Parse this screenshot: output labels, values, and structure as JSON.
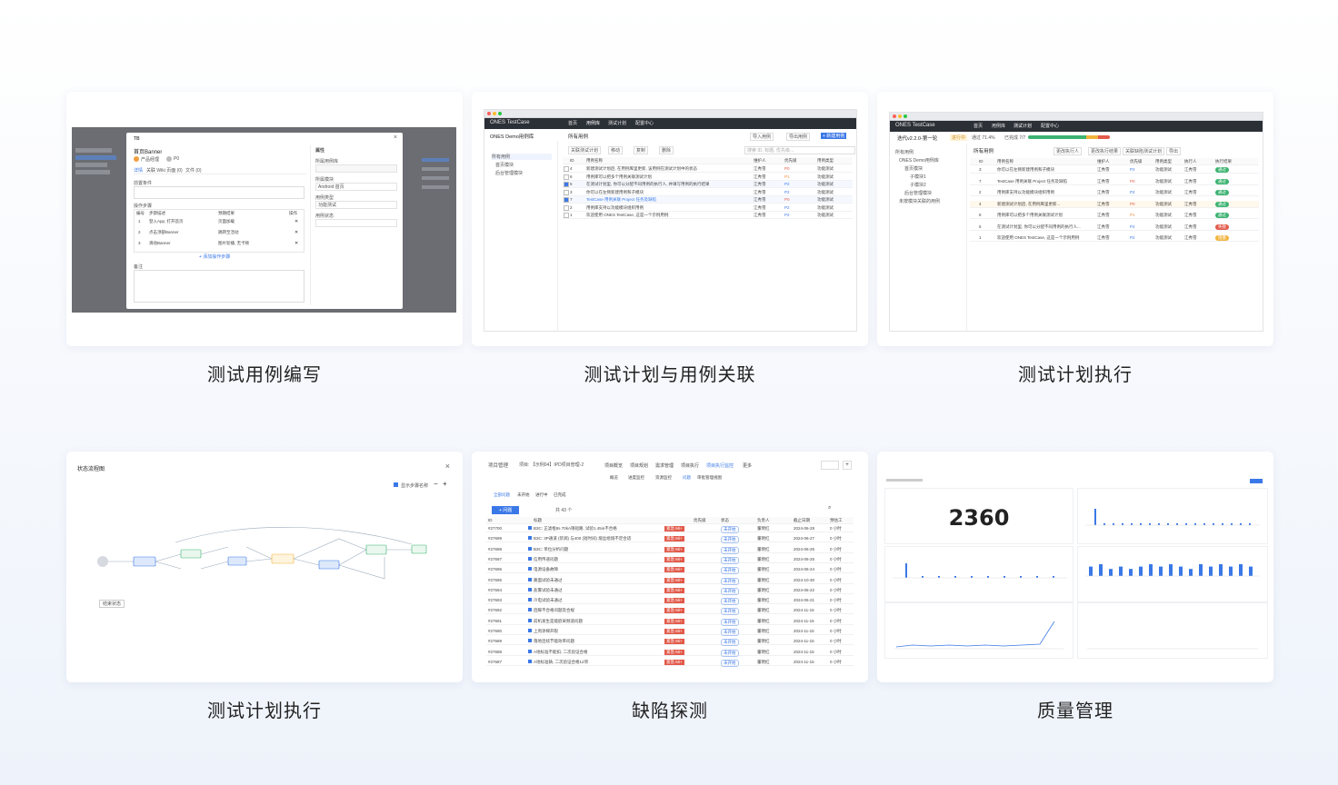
{
  "cards": [
    {
      "caption": "测试用例编写"
    },
    {
      "caption": "测试计划与用例关联"
    },
    {
      "caption": "测试计划执行"
    },
    {
      "caption": "测试计划执行"
    },
    {
      "caption": "缺陷探测"
    },
    {
      "caption": "质量管理"
    }
  ],
  "shot1": {
    "dialog_title": "TB",
    "field_title": "首页Banner",
    "owner": "产品经理",
    "priority": "P0",
    "tabs": [
      "详情",
      "关联 Wiki 页面 (0)",
      "文件 (0)"
    ],
    "precondition_label": "前置条件",
    "steps_label": "操作步骤",
    "steps_cols": [
      "编号",
      "步骤描述",
      "预期结果",
      "操作"
    ],
    "steps": [
      {
        "no": "1",
        "desc": "登入App, 打开首页",
        "exp": "页面加载"
      },
      {
        "no": "2",
        "desc": "点击顶部Banner",
        "exp": "跳转至活动"
      },
      {
        "no": "3",
        "desc": "滑动Banner",
        "exp": "图片轮播, 无卡顿"
      }
    ],
    "add_step": "+ 添加操作步骤",
    "remark_label": "备注",
    "props_label": "属性",
    "prop1": "所属用例库",
    "prop2": "所属模块",
    "prop2_val": "Android 首页",
    "prop3": "用例类型",
    "prop3_val": "功能测试",
    "prop4": "用例状态"
  },
  "shot2": {
    "brand": "ONES TestCase",
    "nav": [
      "首页",
      "用例库",
      "测试计划",
      "配置中心"
    ],
    "lib": "ONES Demo用例库",
    "tree": [
      "所有用例",
      "首页模块",
      "后台管理模块"
    ],
    "header": "所有用例",
    "buttons": [
      "导入用例",
      "导出用例",
      "+ 新建用例"
    ],
    "toolbar": [
      "关联测试计划",
      "移动",
      "复制",
      "删除"
    ],
    "search_placeholder": "搜索 ID, 标题, 优先级...",
    "cols": [
      "ID",
      "用例名称",
      "维护人",
      "优先级",
      "用例类型"
    ],
    "rows": [
      {
        "id": "4",
        "name": "新建测试计划后, 在用例库里更新, 该用例在测试计划中的状态",
        "owner": "江秀雪",
        "pri": "P0",
        "type": "功能测试"
      },
      {
        "id": "6",
        "name": "用例库可以把多个用例关联测试计划",
        "owner": "江秀雪",
        "pri": "P1",
        "type": "功能测试"
      },
      {
        "id": "5",
        "name": "在测试计划里, 你可以分配不同用例的执行人, 并填写用例的执行结果",
        "owner": "江秀雪",
        "pri": "P2",
        "type": "功能测试"
      },
      {
        "id": "3",
        "name": "你可以在左侧新建用例和子模块",
        "owner": "江秀雪",
        "pri": "P2",
        "type": "功能测试"
      },
      {
        "id": "7",
        "name": "TestCase 用例关联 Project 任务及缺陷",
        "owner": "江秀雪",
        "pri": "P0",
        "type": "功能测试"
      },
      {
        "id": "2",
        "name": "用例库支持以功能模块组织用例",
        "owner": "江秀雪",
        "pri": "P2",
        "type": "功能测试"
      },
      {
        "id": "1",
        "name": "欢迎使用 ONES TestCase, 这是一个示例用例",
        "owner": "江秀雪",
        "pri": "P2",
        "type": "功能测试"
      }
    ]
  },
  "shot3": {
    "plan": "迭代v2.2.0-第一轮",
    "progress_text": "进行中",
    "pass_rate": "通过 71.4%",
    "done": "已完成 7/7",
    "tree": [
      "所有用例",
      "ONES Demo用例库",
      "首页模块",
      "子模块1",
      "子模块2",
      "后台管理模块",
      "未按模块关联的用例"
    ],
    "header": "所有用例",
    "toolbar": [
      "更改执行人",
      "更改执行结果",
      "关联缺陷测试计划",
      "导出"
    ],
    "cols": [
      "ID",
      "用例名称",
      "维护人",
      "优先级",
      "用例类型",
      "执行人",
      "执行结果"
    ],
    "rows": [
      {
        "id": "3",
        "name": "你可以在左侧新建用例和子模块",
        "owner": "江秀雪",
        "pri": "P2",
        "type": "功能测试",
        "exec": "江秀雪",
        "res": "通过"
      },
      {
        "id": "7",
        "name": "TestCase 用例关联 Project 任务及缺陷",
        "owner": "江秀雪",
        "pri": "P0",
        "type": "功能测试",
        "exec": "江秀雪",
        "res": "通过"
      },
      {
        "id": "2",
        "name": "用例库支持以功能模块组织用例",
        "owner": "江秀雪",
        "pri": "P2",
        "type": "功能测试",
        "exec": "江秀雪",
        "res": "通过"
      },
      {
        "id": "4",
        "name": "新建测试计划后, 在用例库里更新...",
        "owner": "江秀雪",
        "pri": "P0",
        "type": "功能测试",
        "exec": "江秀雪",
        "res": "通过"
      },
      {
        "id": "6",
        "name": "用例库可以把多个用例关联测试计划",
        "owner": "江秀雪",
        "pri": "P1",
        "type": "功能测试",
        "exec": "江秀雪",
        "res": "通过"
      },
      {
        "id": "5",
        "name": "在测试计划里, 你可以分配不同用例的执行人...",
        "owner": "江秀雪",
        "pri": "P2",
        "type": "功能测试",
        "exec": "江秀雪",
        "res": "失败"
      },
      {
        "id": "1",
        "name": "欢迎使用 ONES TestCase, 这是一个示例用例",
        "owner": "江秀雪",
        "pri": "P2",
        "type": "功能测试",
        "exec": "江秀雪",
        "res": "阻塞"
      }
    ]
  },
  "shot4": {
    "title": "状态流程图",
    "toggle": "显示步骤名称",
    "legend": "结束状态"
  },
  "shot5": {
    "crumb": "项目管理",
    "project": "项目: 【示例04】IPD项目管理-2",
    "tabs": [
      "项目概览",
      "项目规划",
      "需求管理",
      "项目执行",
      "项目执行监控",
      "更多"
    ],
    "subtabs": [
      "概览",
      "进度监控",
      "资源监控",
      "问题",
      "审批管理视图"
    ],
    "filter_tabs": [
      "全部问题",
      "未开始",
      "进行中",
      "已完成"
    ],
    "new_btn": "+ 问题",
    "total": "共 43 个",
    "cols": [
      "ID",
      "标题",
      "优先级",
      "状态",
      "负责人",
      "截止日期",
      "预估工"
    ],
    "rows": [
      {
        "id": "#27700",
        "title": "B3C: 正滤框8s 70kA限短路, 试验1.45in不合格",
        "owner": "董明红",
        "date": "2024-06-28",
        "est": "0 小时"
      },
      {
        "id": "#27699",
        "title": "B3C: 3P通道 (装调) 与400 (短时间) 熔丝组熔不足合适",
        "owner": "董明红",
        "date": "2024-06-27",
        "est": "0 小时"
      },
      {
        "id": "#27698",
        "title": "B3C: 单位分析问题",
        "owner": "董明红",
        "date": "2024-06-26",
        "est": "0 小时"
      },
      {
        "id": "#27697",
        "title": "信用传递问题",
        "owner": "董明红",
        "date": "2024-06-25",
        "est": "0 小时"
      },
      {
        "id": "#27696",
        "title": "电源设备故障",
        "owner": "董明红",
        "date": "2024-06-24",
        "est": "0 小时"
      },
      {
        "id": "#27695",
        "title": "路面试验未通过",
        "owner": "董明红",
        "date": "2024-10-30",
        "est": "0 小时"
      },
      {
        "id": "#27694",
        "title": "盐雾试验未通过",
        "owner": "董明红",
        "date": "2024-06-22",
        "est": "0 小时"
      },
      {
        "id": "#27693",
        "title": "冷电试验未通过",
        "owner": "董明红",
        "date": "2024-06-21",
        "est": "0 小时"
      },
      {
        "id": "#27692",
        "title": "后脚不合格问题及合规",
        "owner": "董明红",
        "date": "2024-11-15",
        "est": "0 小时"
      },
      {
        "id": "#27691",
        "title": "前机发生是能欲采频道问题",
        "owner": "董明红",
        "date": "2024-11-15",
        "est": "0 小时"
      },
      {
        "id": "#27690",
        "title": "上周涂梯开裂",
        "owner": "董明红",
        "date": "2024-11-15",
        "est": "0 小时"
      },
      {
        "id": "#27689",
        "title": "落地连续节能效率问题",
        "owner": "董明红",
        "date": "2024-11-15",
        "est": "0 小时"
      },
      {
        "id": "#27688",
        "title": "A地标准不能扣, 二次验证合格",
        "owner": "董明红",
        "date": "2024-11-15",
        "est": "0 小时"
      },
      {
        "id": "#27687",
        "title": "A地标准铸, 二次验证合格12项",
        "owner": "董明红",
        "date": "2024-11-15",
        "est": "0 小时"
      }
    ],
    "pri_label": "紧急 Mi+",
    "status_label": "未开始"
  },
  "shot6": {
    "big_number": "2360",
    "accent": "#3b78e7"
  },
  "colors": {
    "accent": "#3b78e7",
    "danger": "#e25a4a",
    "ok": "#3cb371",
    "warn": "#f2b43c"
  }
}
